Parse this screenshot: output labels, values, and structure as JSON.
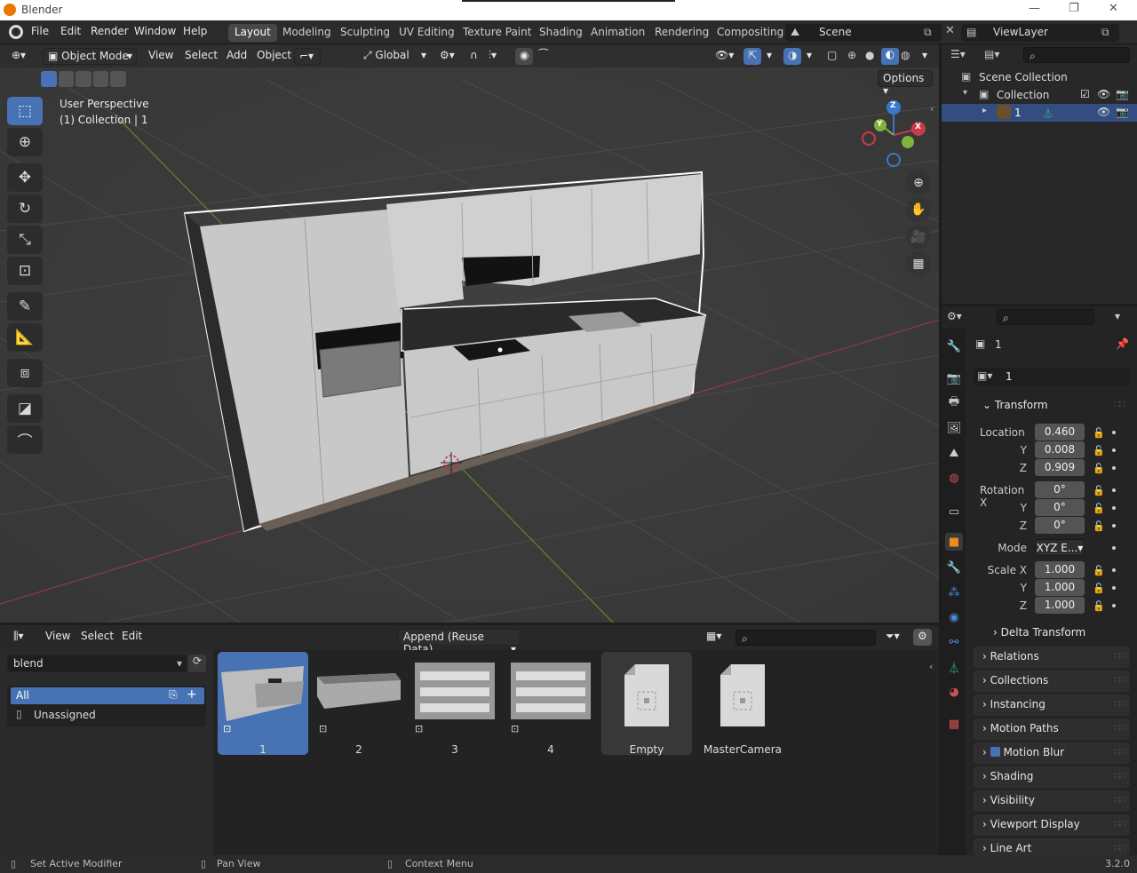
{
  "window": {
    "title": "Blender"
  },
  "menu": [
    "File",
    "Edit",
    "Render",
    "Window",
    "Help"
  ],
  "workspaces": [
    "Layout",
    "Modeling",
    "Sculpting",
    "UV Editing",
    "Texture Paint",
    "Shading",
    "Animation",
    "Rendering",
    "Compositing"
  ],
  "scene": {
    "name": "Scene",
    "view_layer": "ViewLayer"
  },
  "viewport": {
    "mode": "Object Mode",
    "menus": [
      "View",
      "Select",
      "Add",
      "Object"
    ],
    "transform_orientation": "Global",
    "options_label": "Options",
    "info_line1": "User Perspective",
    "info_line2": "(1) Collection | 1",
    "gizmo": {
      "x": "X",
      "y": "Y",
      "z": "Z"
    }
  },
  "outliner": {
    "scene_collection": "Scene Collection",
    "collection": "Collection",
    "object": "1"
  },
  "properties": {
    "object_name": "1",
    "datablock": "1",
    "transform_header": "Transform",
    "location_label": "Location",
    "location": {
      "x": "0.460",
      "y": "0.008",
      "z": "0.909"
    },
    "rotation_label": "Rotation X",
    "rotation": {
      "x": "0°",
      "y": "0°",
      "z": "0°"
    },
    "mode_label": "Mode",
    "mode_value": "XYZ E...",
    "scale_label": "Scale X",
    "scale": {
      "x": "1.000",
      "y": "1.000",
      "z": "1.000"
    },
    "y_label": "Y",
    "z_label": "Z",
    "delta_transform": "Delta Transform",
    "panels": [
      "Relations",
      "Collections",
      "Instancing",
      "Motion Paths",
      "Motion Blur",
      "Shading",
      "Visibility",
      "Viewport Display",
      "Line Art"
    ]
  },
  "asset_browser": {
    "menus": [
      "View",
      "Select",
      "Edit"
    ],
    "import_mode": "Append (Reuse Data)",
    "library": "blend",
    "catalogs": [
      "All",
      "Unassigned"
    ],
    "assets": [
      "1",
      "2",
      "3",
      "4",
      "Empty",
      "MasterCamera"
    ]
  },
  "statusbar": {
    "left": "Set Active Modifier",
    "middle": "Pan View",
    "right": "Context Menu",
    "version": "3.2.0"
  },
  "colors": {
    "accent": "#4772b3",
    "brand_orange": "#ea7600",
    "axis_x": "#c93a4a",
    "axis_y": "#7fb33b",
    "axis_z": "#3a79c9"
  }
}
